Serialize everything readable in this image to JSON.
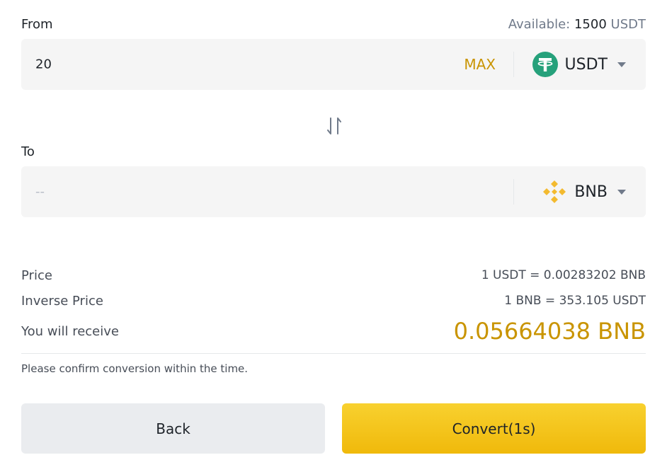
{
  "from": {
    "label": "From",
    "available_label": "Available:",
    "available_amount": "1500",
    "available_unit": "USDT",
    "amount": "20",
    "max_label": "MAX",
    "coin": "USDT"
  },
  "to": {
    "label": "To",
    "amount_placeholder": "--",
    "coin": "BNB"
  },
  "details": {
    "price_label": "Price",
    "price_value": "1 USDT = 0.00283202 BNB",
    "inverse_label": "Inverse Price",
    "inverse_value": "1 BNB = 353.105 USDT",
    "receive_label": "You will receive",
    "receive_value": "0.05664038 BNB"
  },
  "note": "Please confirm conversion within the time.",
  "buttons": {
    "back": "Back",
    "convert": "Convert(1s)"
  },
  "colors": {
    "accent": "#c99400",
    "button_yellow": "#f0b90b",
    "usdt_green": "#26a17b",
    "bnb_yellow": "#f3ba2f"
  },
  "icons": {
    "usdt": "tether-icon",
    "bnb": "bnb-icon",
    "swap": "swap-arrows-icon",
    "caret": "caret-down-icon"
  }
}
